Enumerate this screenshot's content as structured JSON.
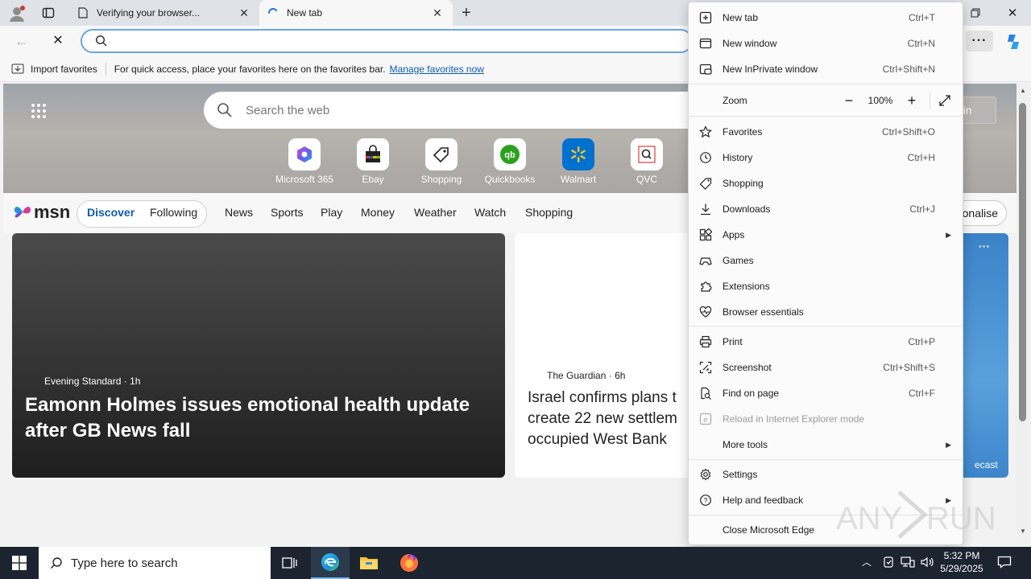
{
  "browser": {
    "tabs": [
      {
        "title": "Verifying your browser...",
        "icon": "document-icon"
      },
      {
        "title": "New tab",
        "icon": "loading-spinner-icon"
      }
    ],
    "address": {
      "value": "",
      "placeholder": ""
    },
    "favorites_bar": {
      "import_label": "Import favorites",
      "hint": "For quick access, place your favorites here on the favorites bar.",
      "manage_link": "Manage favorites now"
    }
  },
  "newtab": {
    "search_placeholder": "Search the web",
    "signin_partial": "n in",
    "personalise_partial": "onalise",
    "quick_links": [
      {
        "label": "Microsoft 365",
        "icon": "microsoft365-icon"
      },
      {
        "label": "Ebay",
        "icon": "ebay-bag-icon"
      },
      {
        "label": "Shopping",
        "icon": "tag-icon"
      },
      {
        "label": "Quickbooks",
        "icon": "quickbooks-icon"
      },
      {
        "label": "Walmart",
        "icon": "walmart-icon"
      },
      {
        "label": "QVC",
        "icon": "qvc-icon"
      }
    ],
    "msn_logo": "msn",
    "feed_tabs": [
      "Discover",
      "Following"
    ],
    "nav": [
      "News",
      "Sports",
      "Play",
      "Money",
      "Weather",
      "Watch",
      "Shopping"
    ],
    "cards": [
      {
        "source": "Evening Standard",
        "age": "1h",
        "headline": "Eamonn Holmes issues emotional health update after GB News fall"
      },
      {
        "source": "The Guardian",
        "age": "6h",
        "headline_lines": [
          "Israel confirms plans t",
          "create 22 new settlem",
          "occupied West Bank"
        ]
      }
    ],
    "weather_partial": "ecast"
  },
  "menu": {
    "zoom_label": "Zoom",
    "zoom_value": "100%",
    "items": [
      {
        "label": "New tab",
        "shortcut": "Ctrl+T"
      },
      {
        "label": "New window",
        "shortcut": "Ctrl+N"
      },
      {
        "label": "New InPrivate window",
        "shortcut": "Ctrl+Shift+N"
      },
      {
        "label": "Favorites",
        "shortcut": "Ctrl+Shift+O"
      },
      {
        "label": "History",
        "shortcut": "Ctrl+H"
      },
      {
        "label": "Shopping",
        "shortcut": ""
      },
      {
        "label": "Downloads",
        "shortcut": "Ctrl+J"
      },
      {
        "label": "Apps",
        "shortcut": ""
      },
      {
        "label": "Games",
        "shortcut": ""
      },
      {
        "label": "Extensions",
        "shortcut": ""
      },
      {
        "label": "Browser essentials",
        "shortcut": ""
      },
      {
        "label": "Print",
        "shortcut": "Ctrl+P"
      },
      {
        "label": "Screenshot",
        "shortcut": "Ctrl+Shift+S"
      },
      {
        "label": "Find on page",
        "shortcut": "Ctrl+F"
      },
      {
        "label": "Reload in Internet Explorer mode",
        "shortcut": ""
      },
      {
        "label": "More tools",
        "shortcut": ""
      },
      {
        "label": "Settings",
        "shortcut": ""
      },
      {
        "label": "Help and feedback",
        "shortcut": ""
      },
      {
        "label": "Close Microsoft Edge",
        "shortcut": ""
      }
    ]
  },
  "taskbar": {
    "search_placeholder": "Type here to search",
    "time": "5:32 PM",
    "date": "5/29/2025"
  },
  "watermark": "ANY RUN",
  "colors": {
    "accent": "#0b5cad",
    "menu_bg": "#fbfbfb",
    "taskbar": "#1c2430"
  }
}
